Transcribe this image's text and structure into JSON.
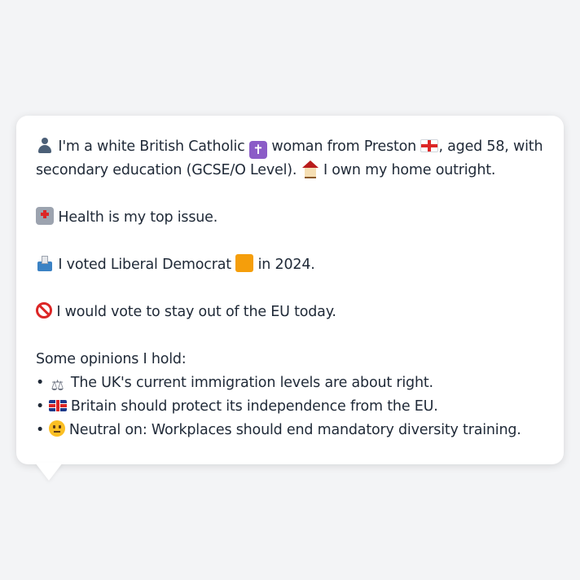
{
  "profile": {
    "identity": {
      "part1": " I'm a white British Catholic ",
      "part2": " woman from Preston ",
      "part3": ", aged 58, with secondary education (GCSE/O Level). ",
      "part4": " I own my home outright."
    },
    "issue": {
      "text": " Health is my top issue."
    },
    "vote": {
      "part1": " I voted Liberal Democrat ",
      "part2": " in 2024."
    },
    "eu": {
      "text": " I would vote to stay out of the EU today."
    },
    "opinions": {
      "heading": "Some opinions I hold:",
      "items": [
        {
          "bullet": "• ",
          "text": " The UK's current immigration levels are about right."
        },
        {
          "bullet": "• ",
          "text": " Britain should protect its independence from the EU."
        },
        {
          "bullet": "• ",
          "text": " Neutral on: Workplaces should end mandatory diversity training."
        }
      ]
    }
  },
  "icons": {
    "identity": "bust-icon",
    "religion": "latin-cross-icon",
    "region": "england-flag-icon",
    "home": "house-icon",
    "issue": "hospital-icon",
    "vote": "ballot-box-icon",
    "party_color": "orange-square-icon",
    "eu": "prohibited-icon",
    "opinion_1": "balance-scale-icon",
    "opinion_2": "uk-flag-icon",
    "opinion_3": "neutral-face-icon",
    "scales_glyph": "⚖",
    "cross_glyph": "✝"
  },
  "colors": {
    "background": "#f3f4f6",
    "bubble": "#ffffff",
    "text": "#1f2937",
    "party": "#f59e0b"
  }
}
